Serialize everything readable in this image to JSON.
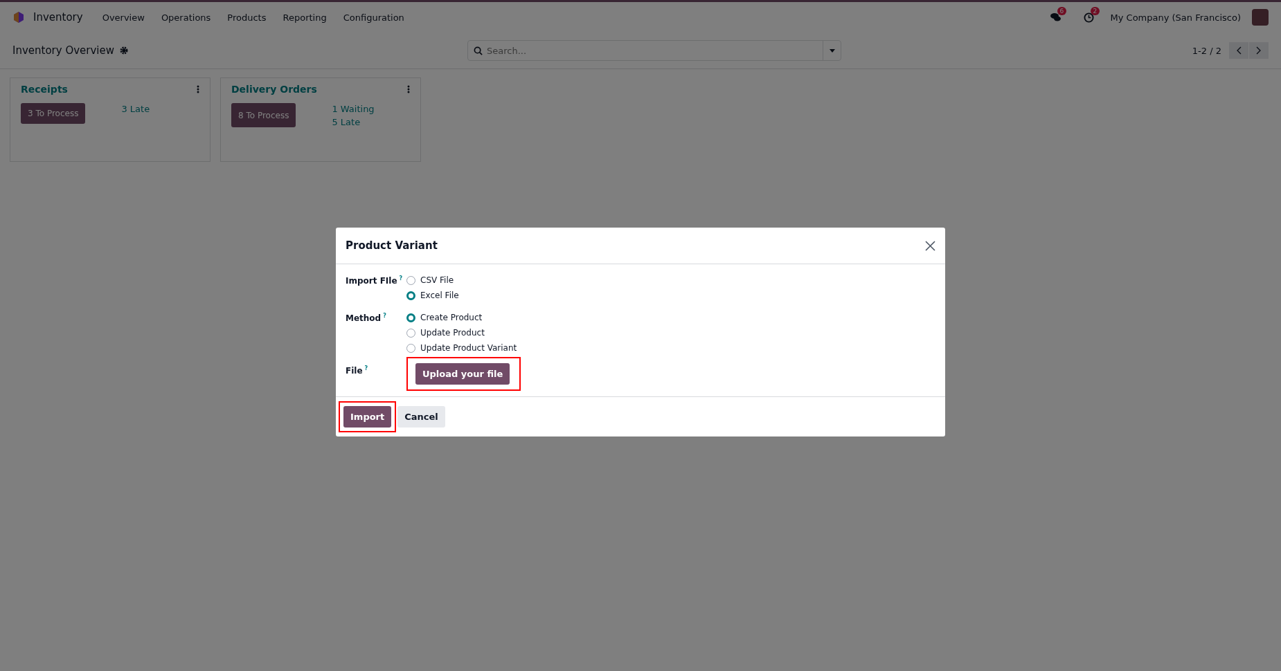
{
  "navbar": {
    "app_name": "Inventory",
    "menu": [
      "Overview",
      "Operations",
      "Products",
      "Reporting",
      "Configuration"
    ],
    "messages_badge": "6",
    "activities_badge": "2",
    "company": "My Company (San Francisco)"
  },
  "control_panel": {
    "title": "Inventory Overview",
    "search": {
      "placeholder": "Search..."
    },
    "pager": "1-2 / 2"
  },
  "cards": [
    {
      "title": "Receipts",
      "button": "3 To Process",
      "links": [
        "3 Late"
      ]
    },
    {
      "title": "Delivery Orders",
      "button": "8 To Process",
      "links": [
        "1 Waiting",
        "5 Late"
      ]
    }
  ],
  "dialog": {
    "title": "Product Variant",
    "fields": [
      {
        "label": "Import FIle",
        "help": "?",
        "kind": "radio",
        "options": [
          {
            "label": "CSV File",
            "selected": false
          },
          {
            "label": "Excel File",
            "selected": true
          }
        ]
      },
      {
        "label": "Method",
        "help": "?",
        "kind": "radio",
        "options": [
          {
            "label": "Create Product",
            "selected": true
          },
          {
            "label": "Update Product",
            "selected": false
          },
          {
            "label": "Update Product Variant",
            "selected": false
          }
        ]
      },
      {
        "label": "File",
        "help": "?",
        "kind": "upload",
        "button": "Upload your file",
        "highlighted": true
      }
    ],
    "buttons": [
      {
        "label": "Import",
        "kind": "primary",
        "highlighted": true
      },
      {
        "label": "Cancel",
        "kind": "secondary",
        "highlighted": false
      }
    ]
  }
}
